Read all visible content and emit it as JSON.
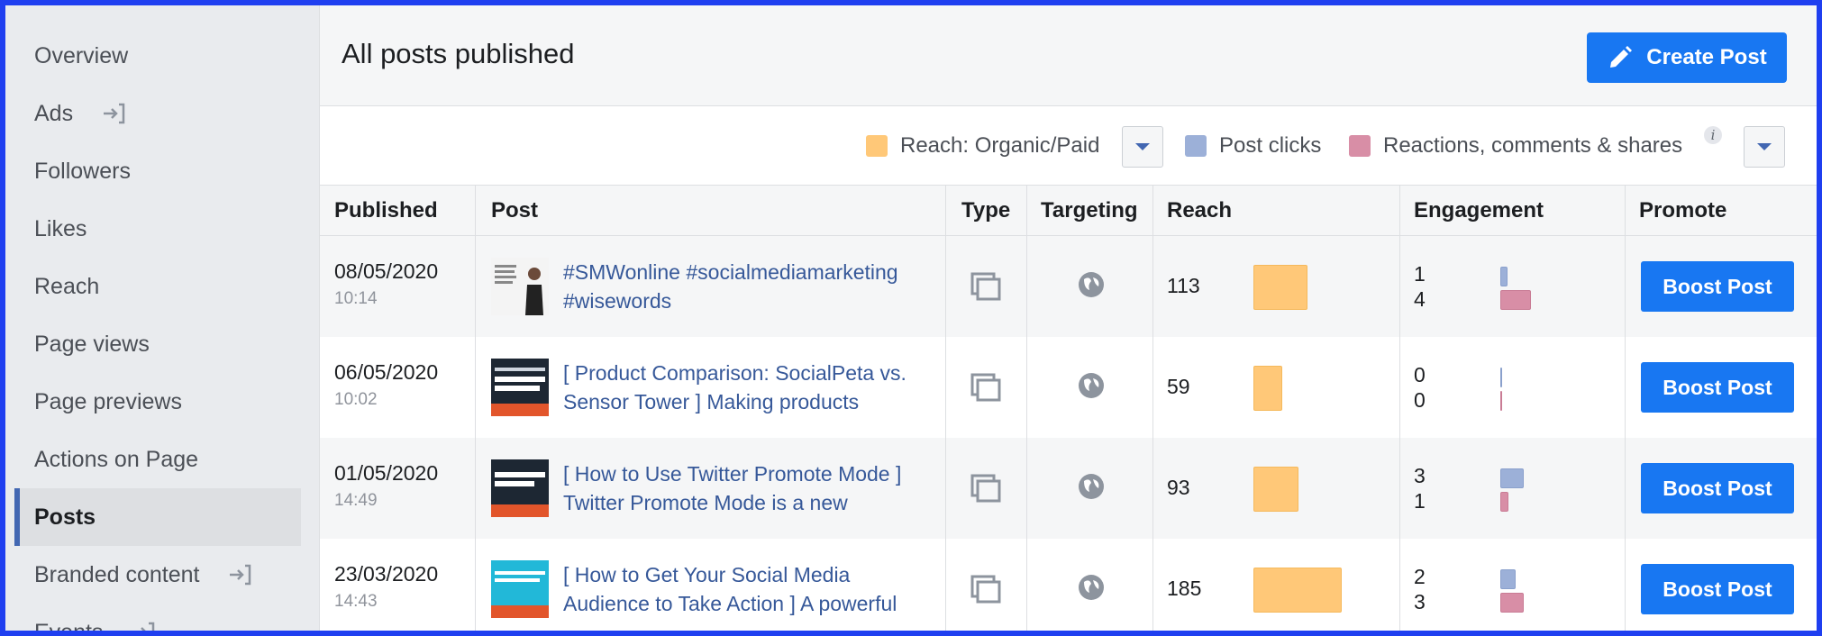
{
  "sidebar": {
    "items": [
      {
        "label": "Overview",
        "external": false,
        "active": false
      },
      {
        "label": "Ads",
        "external": true,
        "active": false
      },
      {
        "label": "Followers",
        "external": false,
        "active": false
      },
      {
        "label": "Likes",
        "external": false,
        "active": false
      },
      {
        "label": "Reach",
        "external": false,
        "active": false
      },
      {
        "label": "Page views",
        "external": false,
        "active": false
      },
      {
        "label": "Page previews",
        "external": false,
        "active": false
      },
      {
        "label": "Actions on Page",
        "external": false,
        "active": false
      },
      {
        "label": "Posts",
        "external": false,
        "active": true
      },
      {
        "label": "Branded content",
        "external": true,
        "active": false
      },
      {
        "label": "Events",
        "external": true,
        "active": false
      }
    ]
  },
  "header": {
    "title": "All posts published",
    "create_label": "Create Post"
  },
  "legend": {
    "reach": "Reach: Organic/Paid",
    "clicks": "Post clicks",
    "reactions": "Reactions, comments & shares",
    "colors": {
      "reach": "#ffc878",
      "clicks": "#9cb0d8",
      "reactions": "#d88ea6"
    }
  },
  "table": {
    "headers": {
      "published": "Published",
      "post": "Post",
      "type": "Type",
      "targeting": "Targeting",
      "reach": "Reach",
      "engagement": "Engagement",
      "promote": "Promote"
    },
    "rows": [
      {
        "date": "08/05/2020",
        "time": "10:14",
        "post_line1": "#SMWonline #socialmediamarketing",
        "post_line2": "#wisewords",
        "reach": "113",
        "clicks": "1",
        "reactions": "4",
        "boost": "Boost Post"
      },
      {
        "date": "06/05/2020",
        "time": "10:02",
        "post_line1": "[ Product Comparison: SocialPeta vs.",
        "post_line2": "Sensor Tower ] Making products",
        "reach": "59",
        "clicks": "0",
        "reactions": "0",
        "boost": "Boost Post"
      },
      {
        "date": "01/05/2020",
        "time": "14:49",
        "post_line1": "[ How to Use Twitter Promote Mode ]",
        "post_line2": "Twitter Promote Mode is a new",
        "reach": "93",
        "clicks": "3",
        "reactions": "1",
        "boost": "Boost Post"
      },
      {
        "date": "23/03/2020",
        "time": "14:43",
        "post_line1": "[ How to Get Your Social Media",
        "post_line2": "Audience to Take Action ] A powerful",
        "reach": "185",
        "clicks": "2",
        "reactions": "3",
        "boost": "Boost Post"
      }
    ]
  }
}
